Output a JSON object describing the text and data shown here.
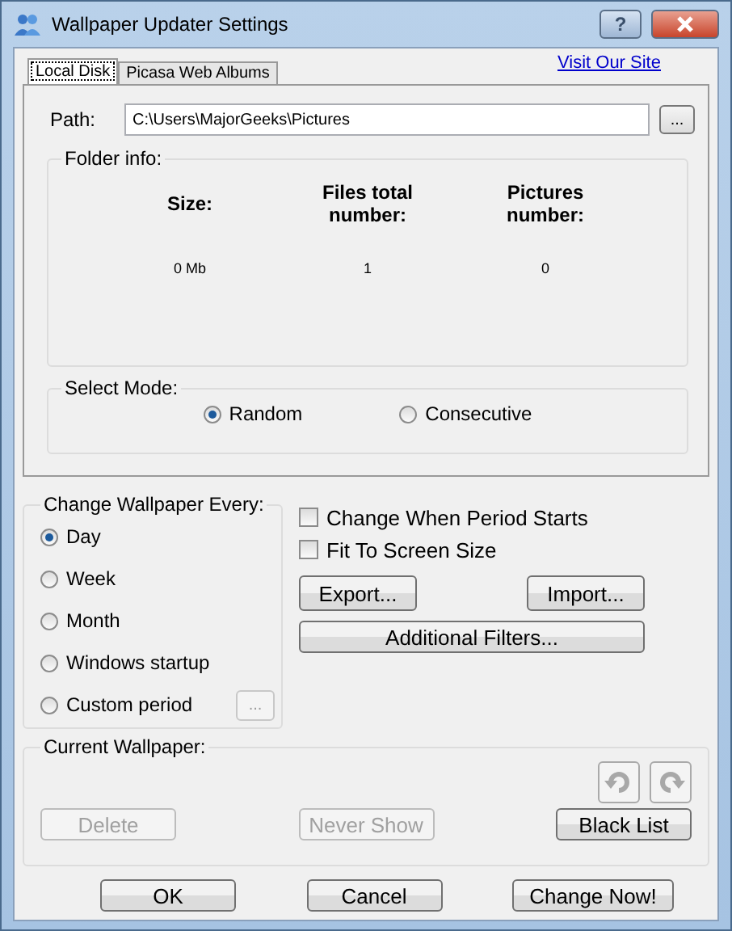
{
  "window": {
    "title": "Wallpaper Updater Settings",
    "help_label": "?"
  },
  "tabs": [
    {
      "label": "Local Disk",
      "selected": true
    },
    {
      "label": "Picasa Web Albums",
      "selected": false
    }
  ],
  "link": "Visit Our Site",
  "path": {
    "label": "Path:",
    "value": "C:\\Users\\MajorGeeks\\Pictures",
    "browse_label": "..."
  },
  "folder_info": {
    "title": "Folder info:",
    "columns": [
      {
        "heading": "Size:",
        "value": "0 Mb"
      },
      {
        "heading": "Files total number:",
        "value": "1"
      },
      {
        "heading": "Pictures number:",
        "value": "0"
      }
    ]
  },
  "select_mode": {
    "title": "Select Mode:",
    "options": [
      {
        "label": "Random",
        "selected": true
      },
      {
        "label": "Consecutive",
        "selected": false
      }
    ]
  },
  "change_every": {
    "title": "Change Wallpaper Every:",
    "options": [
      {
        "label": "Day",
        "selected": true
      },
      {
        "label": "Week",
        "selected": false
      },
      {
        "label": "Month",
        "selected": false
      },
      {
        "label": "Windows startup",
        "selected": false
      },
      {
        "label": "Custom period",
        "selected": false
      }
    ],
    "custom_button": {
      "label": "...",
      "disabled": true
    }
  },
  "checkboxes": [
    {
      "label": "Change When Period Starts",
      "checked": false
    },
    {
      "label": "Fit To Screen Size",
      "checked": false
    }
  ],
  "action_buttons": [
    {
      "label": "Export..."
    },
    {
      "label": "Import..."
    },
    {
      "label": "Additional Filters..."
    }
  ],
  "current_wallpaper": {
    "title": "Current Wallpaper:",
    "rotate_disabled": true,
    "buttons": [
      {
        "label": "Delete",
        "disabled": true
      },
      {
        "label": "Never Show",
        "disabled": true
      },
      {
        "label": "Black List",
        "disabled": false
      }
    ]
  },
  "dialog_buttons": [
    {
      "label": "OK"
    },
    {
      "label": "Cancel"
    },
    {
      "label": "Change Now!"
    }
  ]
}
